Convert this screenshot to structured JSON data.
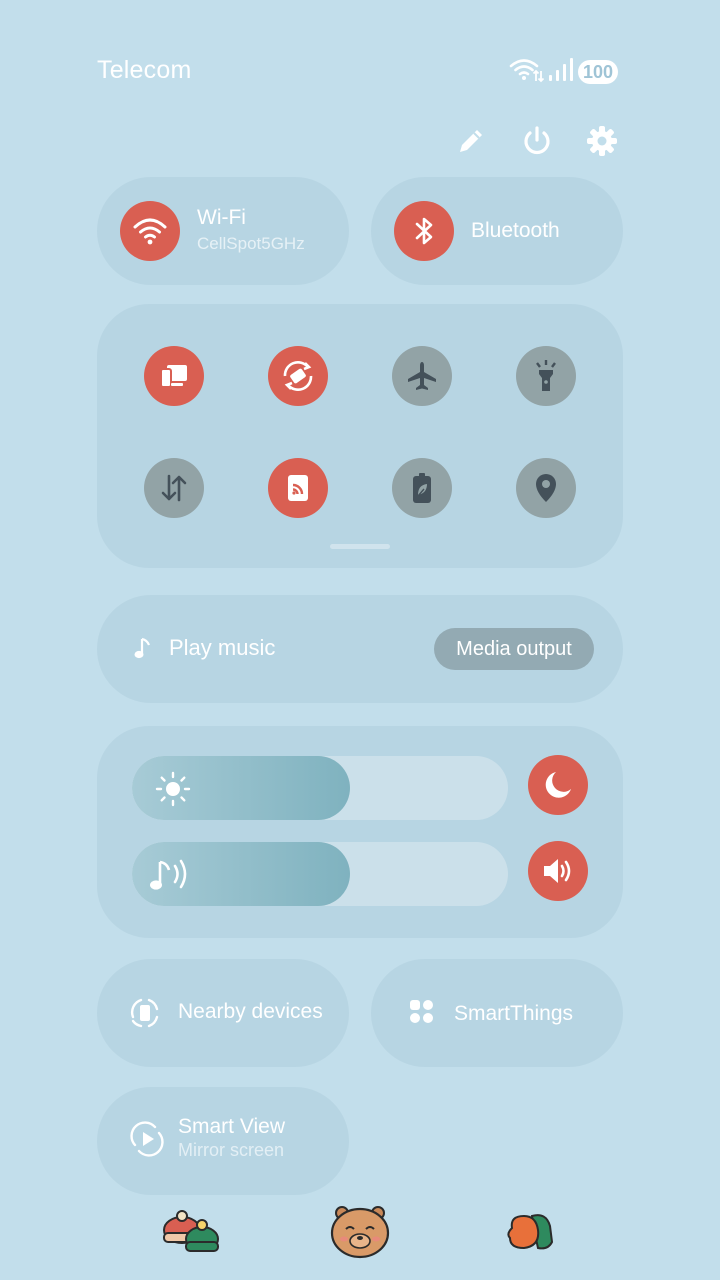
{
  "status_bar": {
    "carrier": "Telecom",
    "battery": "100",
    "wifi_icon": "wifi-data-icon",
    "signal_icon": "signal-icon"
  },
  "top_actions": [
    {
      "name": "edit",
      "icon": "pencil-icon"
    },
    {
      "name": "power",
      "icon": "power-icon"
    },
    {
      "name": "settings",
      "icon": "gear-icon"
    }
  ],
  "wifi_tile": {
    "title": "Wi-Fi",
    "subtitle": "CellSpot5GHz",
    "active": true
  },
  "bluetooth_tile": {
    "title": "Bluetooth",
    "active": true
  },
  "quick_toggles": [
    {
      "icon": "dex-icon",
      "active": true
    },
    {
      "icon": "auto-rotate-icon",
      "active": true
    },
    {
      "icon": "airplane-icon",
      "active": false
    },
    {
      "icon": "flashlight-icon",
      "active": false
    },
    {
      "icon": "mobile-data-icon",
      "active": false
    },
    {
      "icon": "hotspot-icon",
      "active": true
    },
    {
      "icon": "power-saving-icon",
      "active": false
    },
    {
      "icon": "location-icon",
      "active": false
    }
  ],
  "media": {
    "label": "Play music",
    "output_button": "Media output"
  },
  "sliders": {
    "brightness": {
      "level": 0.58,
      "icon": "sun-icon"
    },
    "volume": {
      "level": 0.58,
      "icon": "music-volume-icon"
    },
    "night_mode_icon": "moon-icon",
    "sound_icon": "speaker-icon"
  },
  "bottom_tiles": {
    "nearby": "Nearby devices",
    "smartthings": "SmartThings",
    "smartview_title": "Smart View",
    "smartview_sub": "Mirror screen"
  },
  "stickers": [
    "beanie-hats-sticker",
    "capybara-sticker",
    "mittens-sticker"
  ],
  "colors": {
    "background": "#c2deeb",
    "accent_on": "#d95f52",
    "toggle_off": "#92a3a6"
  }
}
